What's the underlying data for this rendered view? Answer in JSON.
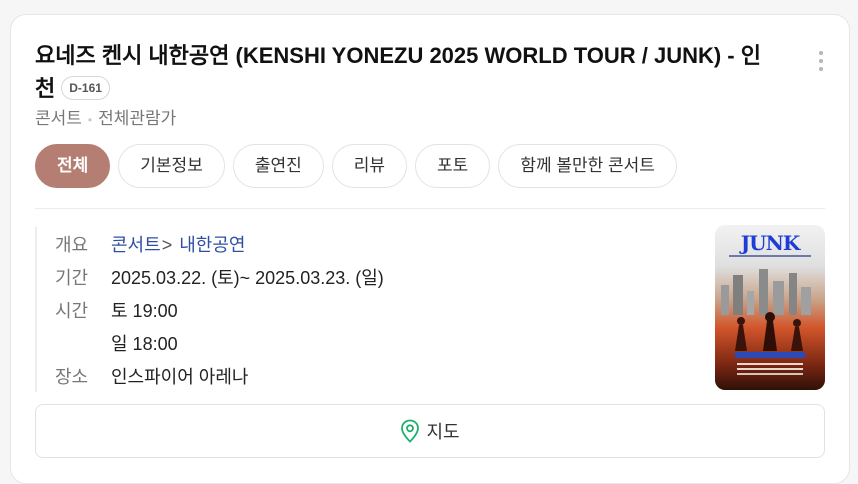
{
  "title": "요네즈 켄시 내한공연 (KENSHI YONEZU 2025 WORLD TOUR / JUNK) - 인천",
  "dday": "D-161",
  "meta": {
    "category": "콘서트",
    "rating": "전체관람가"
  },
  "tabs": [
    {
      "label": "전체",
      "active": true
    },
    {
      "label": "기본정보"
    },
    {
      "label": "출연진"
    },
    {
      "label": "리뷰"
    },
    {
      "label": "포토"
    },
    {
      "label": "함께 볼만한 콘서트"
    }
  ],
  "info": {
    "overview_label": "개요",
    "overview_cat": "콘서트",
    "overview_sep": ">",
    "overview_sub": "내한공연",
    "period_label": "기간",
    "period_value": "2025.03.22. (토)~ 2025.03.23. (일)",
    "time_label": "시간",
    "time_line1": "토 19:00",
    "time_line2": "일 18:00",
    "venue_label": "장소",
    "venue_value": "인스파이어 아레나"
  },
  "poster": {
    "logo": "JUNK",
    "icon": "concert-poster-image"
  },
  "map_button": {
    "label": "지도",
    "icon": "map-pin-icon"
  },
  "colors": {
    "accent": "#b47f72",
    "link": "#2f4fa5",
    "pin": "#1fae6e"
  }
}
